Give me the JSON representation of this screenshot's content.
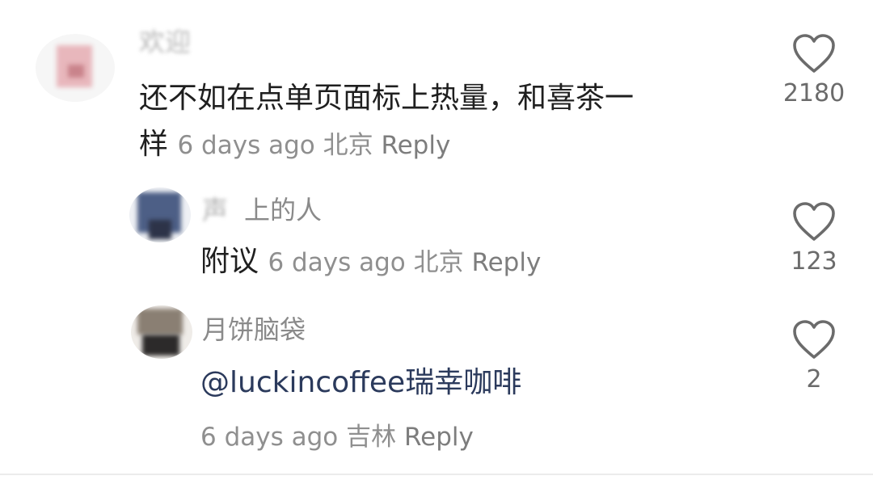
{
  "comments": [
    {
      "username": "欢迎",
      "text_line1": "还不如在点单页面标上热量，和喜茶一",
      "text_line2": "样",
      "time": "6 days ago",
      "location": "北京",
      "reply_label": "Reply",
      "like_count": "2180"
    },
    {
      "username": "声 上的人",
      "text": "附议",
      "time": "6 days ago",
      "location": "北京",
      "reply_label": "Reply",
      "like_count": "123"
    },
    {
      "username": "月饼脑袋",
      "mention": "@luckincoffee瑞幸咖啡",
      "time": "6 days ago",
      "location": "吉林",
      "reply_label": "Reply",
      "like_count": "2"
    }
  ],
  "colors": {
    "text": "#1f1f1f",
    "meta": "#8f8f8f",
    "mention": "#2b3a5c",
    "like_icon": "#6b6b6b"
  },
  "icons": [
    "heart-icon",
    "avatar"
  ]
}
